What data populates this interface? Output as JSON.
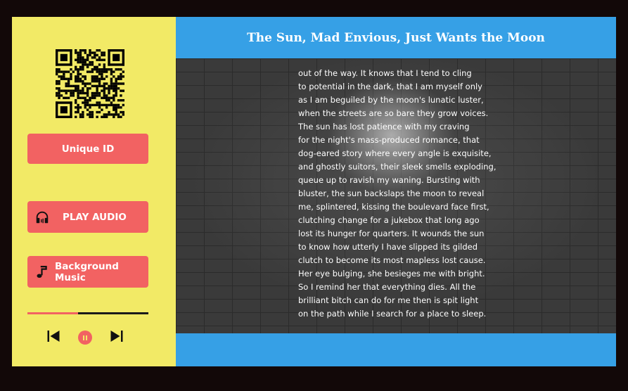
{
  "sidebar": {
    "qr_icon": "qr-code-icon",
    "unique_id_label": "Unique ID",
    "play_audio_label": "PLAY AUDIO",
    "play_audio_icon": "headphones-icon",
    "background_music_label": "Background Music",
    "background_music_icon": "music-note-icon",
    "progress": 0.42,
    "controls": {
      "prev_icon": "skip-previous-icon",
      "pause_icon": "pause-icon",
      "next_icon": "skip-next-icon"
    }
  },
  "main": {
    "title": "The Sun, Mad Envious, Just Wants the Moon",
    "poem_lines": [
      "out of the way. It knows that I tend to cling",
      "to potential in the dark, that I am myself only",
      "as I am beguiled by the moon's lunatic luster,",
      "when the streets are so bare they grow voices.",
      "The sun has lost patience with my craving",
      "for the night's mass-produced romance, that",
      "dog-eared story where every angle is exquisite,",
      "and ghostly suitors, their sleek smells exploding,",
      "queue up to ravish my waning. Bursting with",
      "bluster, the sun backslaps the moon to reveal",
      "me, splintered, kissing the boulevard face first,",
      "clutching change for a jukebox that long ago",
      "lost its hunger for quarters. It wounds the sun",
      "to know how utterly I have slipped its gilded",
      "clutch to become its most mapless lost cause.",
      "Her eye bulging, she besieges me with bright.",
      "So I remind her that everything dies. All the",
      "brilliant bitch can do for me then is spit light",
      "on the path while I search for a place to sleep."
    ]
  },
  "colors": {
    "sidebar_bg": "#f2ea66",
    "button": "#f26262",
    "header": "#36a0e6",
    "page_bg": "#120808"
  }
}
